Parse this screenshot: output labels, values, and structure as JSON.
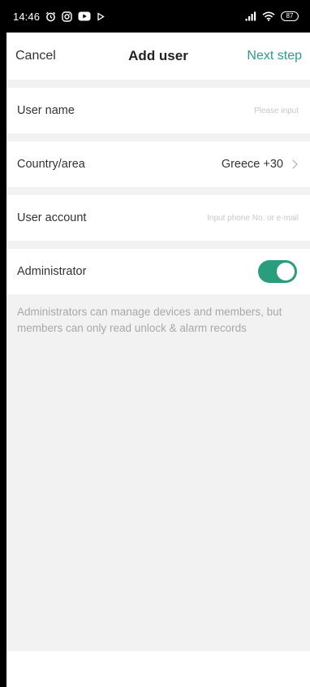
{
  "status_bar": {
    "time": "14:46",
    "battery": "87",
    "icons": [
      "alarm-icon",
      "instagram-icon",
      "youtube-icon",
      "play-icon",
      "signal-icon",
      "wifi-icon",
      "battery-icon"
    ]
  },
  "nav": {
    "cancel_label": "Cancel",
    "title": "Add user",
    "next_label": "Next step",
    "accent_color": "#2a9d8a"
  },
  "form": {
    "user_name": {
      "label": "User name",
      "placeholder": "Please input",
      "value": ""
    },
    "country": {
      "label": "Country/area",
      "value": "Greece +30"
    },
    "account": {
      "label": "User account",
      "placeholder": "Input phone No. or e-mail",
      "value": ""
    },
    "administrator": {
      "label": "Administrator",
      "enabled": true,
      "toggle_color": "#2a9d7c"
    }
  },
  "hint": "Administrators can manage devices and members, but members can only read unlock & alarm records"
}
